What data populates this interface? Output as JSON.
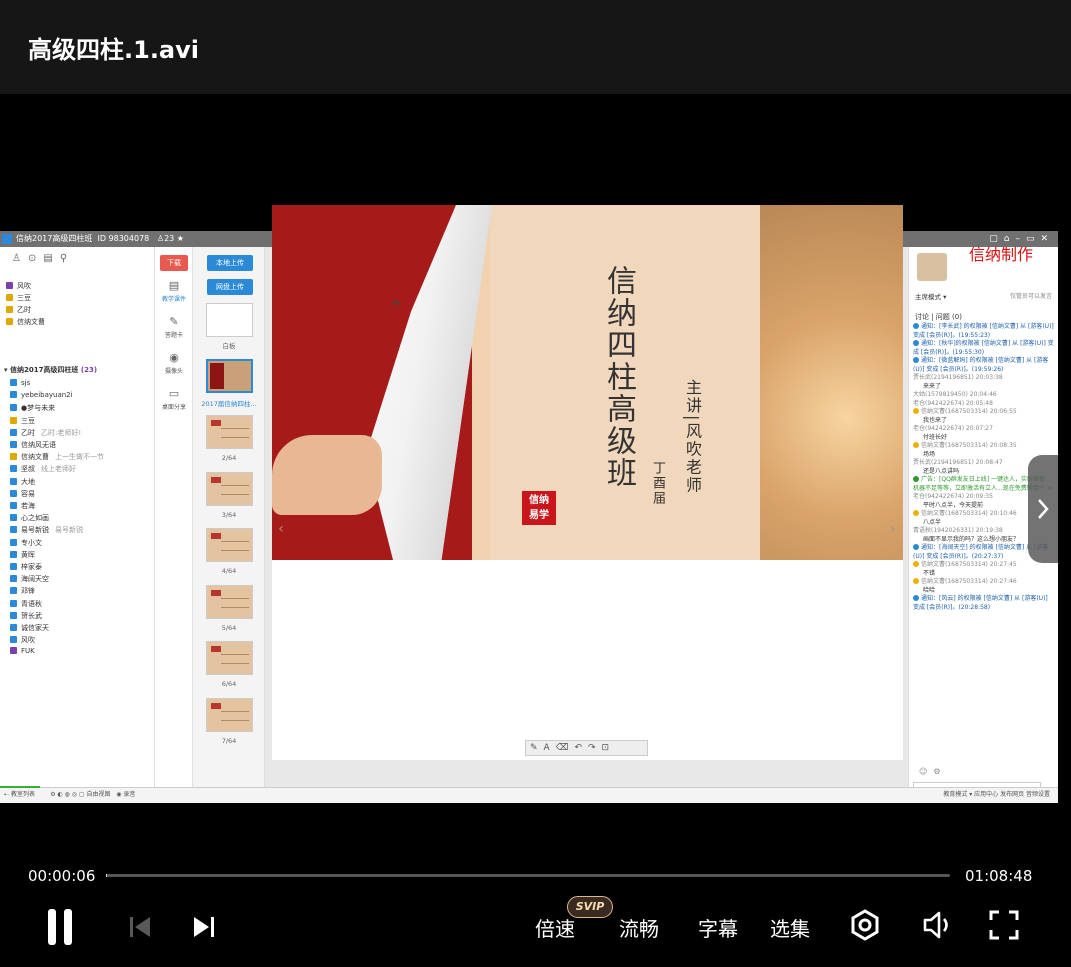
{
  "window": {
    "title": "高级四柱.1.avi"
  },
  "screen": {
    "titlebar": {
      "text": "信纳2017高级四柱班",
      "id_label": "ID",
      "id": "98304078",
      "count": "23"
    },
    "watermark": "信纳制作",
    "left_panel": {
      "top_users": [
        "风吹",
        "三豆",
        "乙时",
        "信纳文曹"
      ],
      "section_title": "信纳2017高级四柱班",
      "section_count": "(23)",
      "members": [
        {
          "name": "sjs",
          "msg": ""
        },
        {
          "name": "yebeibayuan2i",
          "msg": ""
        },
        {
          "name": "●梦与未来",
          "msg": ""
        },
        {
          "name": "三豆",
          "msg": ""
        },
        {
          "name": "乙时",
          "msg": "乙时:老师好!"
        },
        {
          "name": "信纳风无语",
          "msg": ""
        },
        {
          "name": "信纳文曹",
          "msg": "上一生做不一节"
        },
        {
          "name": "坚叔",
          "msg": "线上老师好"
        },
        {
          "name": "大地",
          "msg": ""
        },
        {
          "name": "容易",
          "msg": ""
        },
        {
          "name": "若海",
          "msg": ""
        },
        {
          "name": "心之如画",
          "msg": ""
        },
        {
          "name": "易号新锐",
          "msg": "易号新锐"
        },
        {
          "name": "专小文",
          "msg": ""
        },
        {
          "name": "黄晖",
          "msg": ""
        },
        {
          "name": "梓家泰",
          "msg": ""
        },
        {
          "name": "海阔天空",
          "msg": ""
        },
        {
          "name": "邓锋",
          "msg": ""
        },
        {
          "name": "青语秋",
          "msg": ""
        },
        {
          "name": "贺长武",
          "msg": ""
        },
        {
          "name": "诚信家天",
          "msg": ""
        },
        {
          "name": "风吹",
          "msg": ""
        },
        {
          "name": "FUK",
          "msg": ""
        }
      ]
    },
    "tools": {
      "red_button": "下载",
      "items": [
        "教学课件",
        "答题卡",
        "摄像头",
        "桌面分享"
      ]
    },
    "thumbs": {
      "btn_local": "本地上传",
      "btn_net": "网盘上传",
      "white_label": "白板",
      "selected_label": "2017届信纳四柱...",
      "labels": [
        "2/64",
        "3/64",
        "4/64",
        "5/64",
        "6/64",
        "7/64"
      ]
    },
    "slide": {
      "title": "信纳四柱高级班",
      "speaker": "主讲|风吹老师",
      "year": "丁酉届",
      "seal_top": "信纳",
      "seal_bottom": "易学"
    },
    "right_panel": {
      "mode": "主席模式 ▾",
      "note": "仅管员可以发言",
      "tabs": "讨论 | 问题 (0)",
      "chat": [
        {
          "kind": "sys",
          "text": "通知：[李长武] 的权限被 [信纳文曹] 从 [游客(U)] 变成 [会员(R)]。(19:55:23)"
        },
        {
          "kind": "sys",
          "text": "通知：[秋华]的权限被 [信纳文曹] 从 [游客(U)] 变成 [会员(R)]。(19:55:30)"
        },
        {
          "kind": "sys",
          "text": "通知：[微蓝解妈] 的权限被 [信纳文曹] 从 [游客(U)] 变成 [会员(R)]。(19:59:26)"
        },
        {
          "kind": "name",
          "text": "贾长武(2194196851) 20:03:38"
        },
        {
          "kind": "msg",
          "text": "来来了"
        },
        {
          "kind": "name",
          "text": "大姑(1579819450) 20:04:46"
        },
        {
          "kind": "name",
          "text": "老仓(942422674) 20:05:48"
        },
        {
          "kind": "name",
          "text": "信纳文曹(1687503314) 20:06:55"
        },
        {
          "kind": "msg",
          "text": "我也来了"
        },
        {
          "kind": "name",
          "text": "老仓(942422674) 20:07:27"
        },
        {
          "kind": "msg",
          "text": "付班长好"
        },
        {
          "kind": "name",
          "text": "信纳文曹(1687503314) 20:08:35"
        },
        {
          "kind": "msg",
          "text": "场场"
        },
        {
          "kind": "name",
          "text": "贾长武(2194196851) 20:08:47"
        },
        {
          "kind": "msg",
          "text": "还是八点讲吗"
        },
        {
          "kind": "ad",
          "text": "广告：[QQ群发友日上线] 一键达人，实时群管，机器不足等等，立即激活有立人...现在免费新用户 >"
        },
        {
          "kind": "name",
          "text": "老仓(942422674) 20:09:35"
        },
        {
          "kind": "msg",
          "text": "平时八点半，今天提前"
        },
        {
          "kind": "name",
          "text": "信纳文曹(1687503314) 20:10:46"
        },
        {
          "kind": "msg",
          "text": "八点半"
        },
        {
          "kind": "name",
          "text": "青语秋(1942026331) 20:19:38"
        },
        {
          "kind": "msg",
          "text": "画面不显示我的吗？这么想小朋友？"
        },
        {
          "kind": "sys",
          "text": "通知：[海阔天空] 的权限被 [信纳文曹] 从 [游客(U)] 变成 [会员(R)]。(20:27:37)"
        },
        {
          "kind": "name",
          "text": "信纳文曹(1687503314) 20:27:45"
        },
        {
          "kind": "msg",
          "text": "不错"
        },
        {
          "kind": "name",
          "text": "信纳文曹(1687503314) 20:27:46"
        },
        {
          "kind": "msg",
          "text": "哈哈"
        },
        {
          "kind": "sys",
          "text": "通知：[风云] 的权限被 [信纳文曹] 从 [游客(U)] 变成 [会员(R)]。(20:28:58)"
        }
      ]
    },
    "status_left": "教室列表",
    "status_mid": "自由视图",
    "status_mid2": "录音",
    "status_right": "教育模式 ▾  应用中心  发布网页  音频设置"
  },
  "player": {
    "current_time": "00:00:06",
    "total_time": "01:08:48",
    "progress": 0.0015,
    "speed_label": "倍速",
    "svip_badge": "SVIP",
    "quality_label": "流畅",
    "subtitle_label": "字幕",
    "episode_label": "选集"
  },
  "colors": {
    "accent": "#ffffff",
    "svip": "#d9b98c",
    "watermark": "#e01010"
  }
}
